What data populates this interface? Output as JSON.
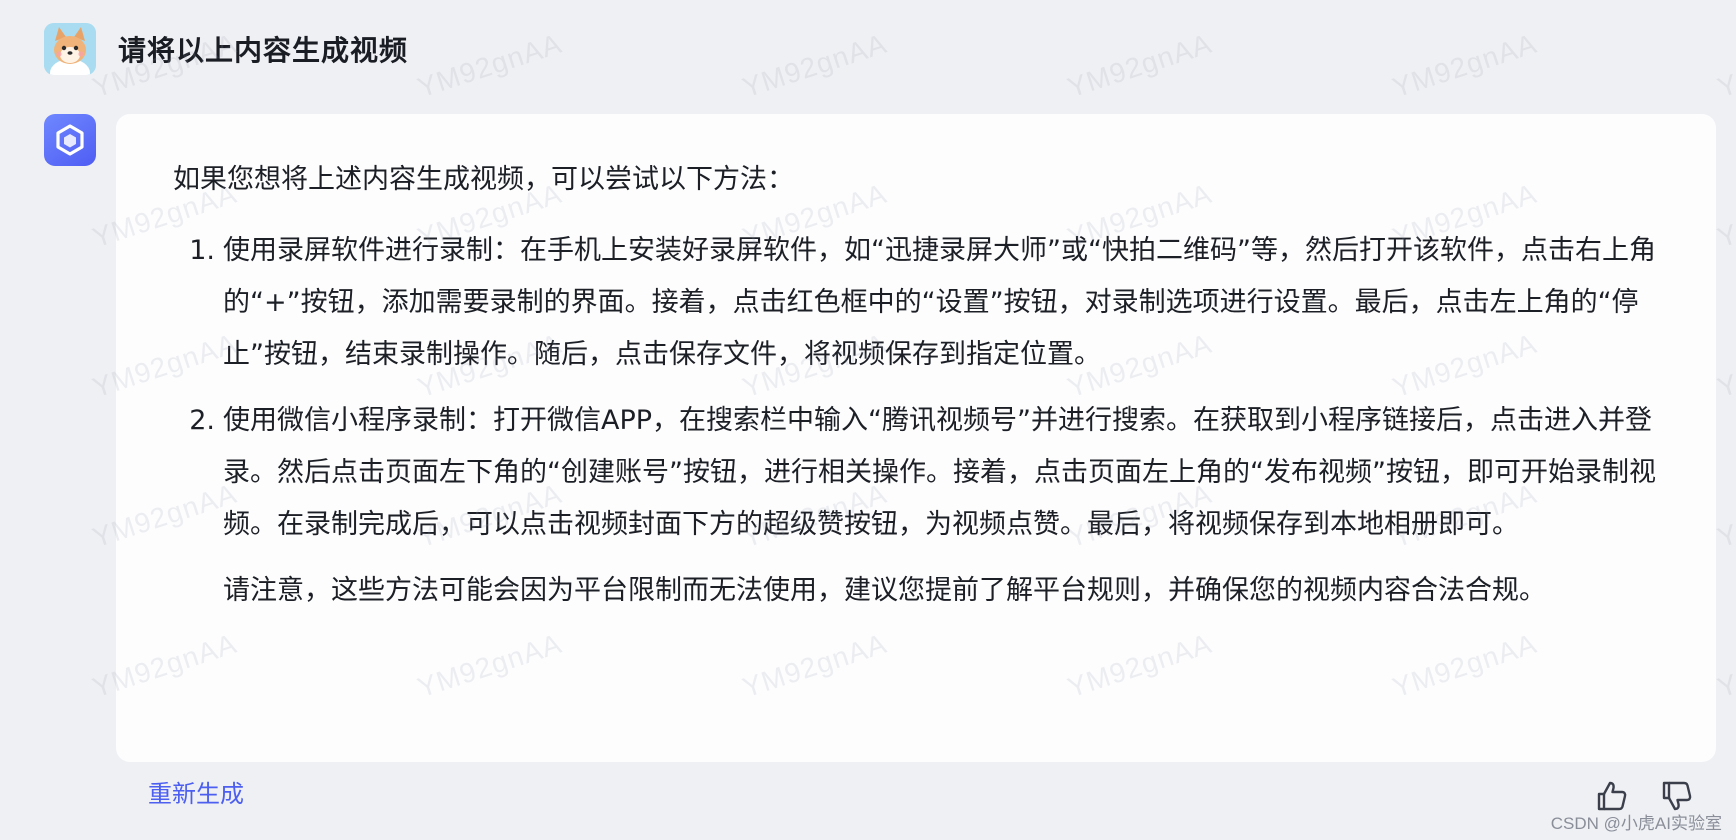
{
  "user": {
    "avatar_icon": "shiba-dog-avatar-icon",
    "prompt": "请将以上内容生成视频"
  },
  "bot": {
    "avatar_icon": "hexagon-logo-icon",
    "intro": "如果您想将上述内容生成视频，可以尝试以下方法：",
    "steps": [
      {
        "num": "1.",
        "text": "使用录屏软件进行录制：在手机上安装好录屏软件，如“迅捷录屏大师”或“快拍二维码”等，然后打开该软件，点击右上角的“+”按钮，添加需要录制的界面。接着，点击红色框中的“设置”按钮，对录制选项进行设置。最后，点击左上角的“停止”按钮，结束录制操作。随后，点击保存文件，将视频保存到指定位置。"
      },
      {
        "num": "2.",
        "text": "使用微信小程序录制：打开微信APP，在搜索栏中输入“腾讯视频号”并进行搜索。在获取到小程序链接后，点击进入并登录。然后点击页面左下角的“创建账号”按钮，进行相关操作。接着，点击页面左上角的“发布视频”按钮，即可开始录制视频。在录制完成后，可以点击视频封面下方的超级赞按钮，为视频点赞。最后，将视频保存到本地相册即可。"
      }
    ],
    "note": "请注意，这些方法可能会因为平台限制而无法使用，建议您提前了解平台规则，并确保您的视频内容合法合规。"
  },
  "footer": {
    "regenerate_label": "重新生成",
    "like_icon": "thumbs-up-icon",
    "dislike_icon": "thumbs-down-icon"
  },
  "watermark": "YM92gnAA",
  "source_mark": "CSDN @小虎AI实验室",
  "colors": {
    "background": "#eff0f4",
    "bubble": "#fdfdfe",
    "accent": "#4c5ff0",
    "text": "#1c1f26"
  }
}
